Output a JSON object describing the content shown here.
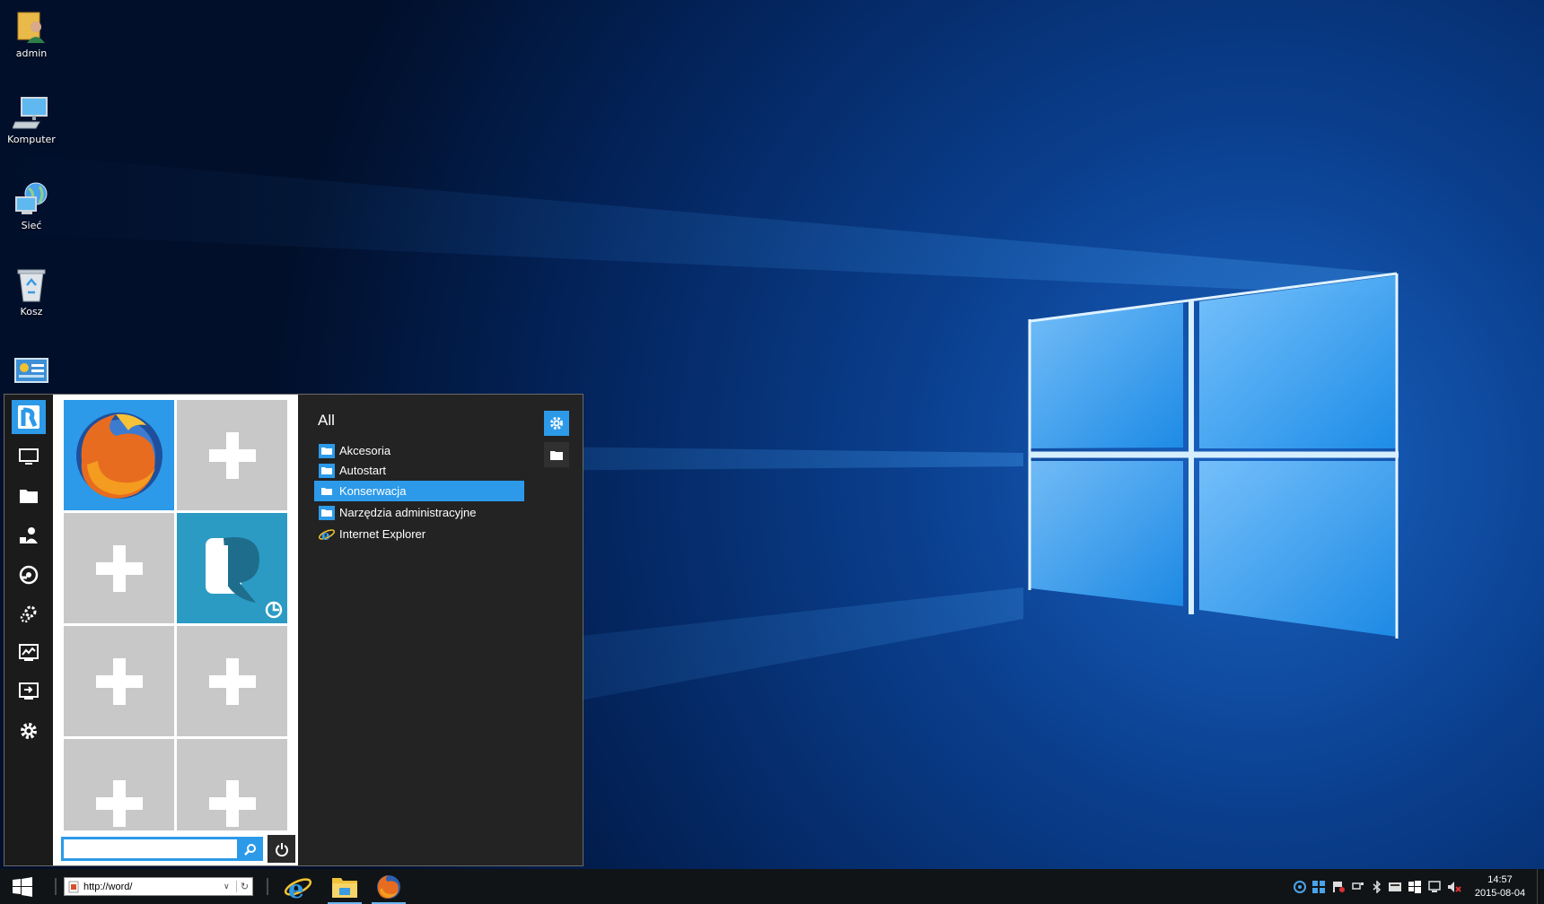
{
  "desktop": {
    "icons": [
      {
        "label": "admin",
        "icon": "user-folder-icon"
      },
      {
        "label": "Komputer",
        "icon": "computer-icon"
      },
      {
        "label": "Sieć",
        "icon": "network-icon"
      },
      {
        "label": "Kosz",
        "icon": "recycle-bin-icon"
      }
    ]
  },
  "start_menu": {
    "rail": [
      "app-logo-icon",
      "desktop-icon",
      "folder-icon",
      "users-icon",
      "network-share-icon",
      "system-settings-icon",
      "performance-monitor-icon",
      "remote-desktop-icon",
      "settings-gear-icon"
    ],
    "tiles": {
      "pinned": [
        "firefox",
        "empty",
        "empty",
        "app",
        "empty",
        "empty",
        "empty",
        "empty"
      ]
    },
    "search": {
      "value": "",
      "placeholder": ""
    },
    "list": {
      "title": "All",
      "items": [
        {
          "label": "Akcesoria",
          "icon": "folder-icon"
        },
        {
          "label": "Autostart",
          "icon": "folder-icon"
        },
        {
          "label": "Konserwacja",
          "icon": "folder-icon",
          "selected": true
        },
        {
          "label": "Narzędzia administracyjne",
          "icon": "folder-icon"
        },
        {
          "label": "Internet Explorer",
          "icon": "internet-explorer-icon"
        }
      ]
    }
  },
  "taskbar": {
    "address": "http://word/",
    "apps": [
      "internet-explorer",
      "file-explorer",
      "firefox"
    ],
    "clock": {
      "time": "14:57",
      "date": "2015-08-04"
    }
  },
  "colors": {
    "accent": "#2c9ae8",
    "tile_gray": "#c8c8c8",
    "menu_bg": "#232323",
    "taskbar_bg": "#111417"
  }
}
